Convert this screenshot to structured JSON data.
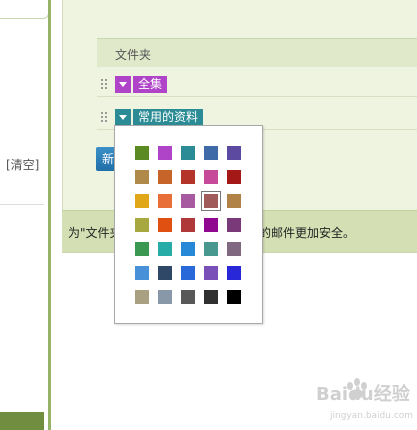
{
  "sidebar": {
    "clear_link": "[清空]"
  },
  "folders": {
    "header": "文件夹",
    "items": [
      {
        "label": "全集",
        "color": "#b044c8"
      },
      {
        "label": "常用的资料",
        "color": "#2b8c96"
      }
    ]
  },
  "new_button": {
    "label": "新"
  },
  "info_bar": {
    "text_left": "为\"文件夹",
    "text_right": "的邮件更加安全。"
  },
  "color_picker": {
    "selected": "#a05a5a",
    "rows": [
      [
        "#5b8a22",
        "#b044c8",
        "#2b8c96",
        "#3f6aa8",
        "#5b4aa0"
      ],
      [
        "#b08a4a",
        "#c7642a",
        "#b4342a",
        "#c74a9a",
        "#a41818"
      ],
      [
        "#e0a818",
        "#e87038",
        "#a85aa0",
        "#a05a5a",
        "#b08248"
      ],
      [
        "#a8a840",
        "#e05010",
        "#b03838",
        "#900890",
        "#7a3a7a"
      ],
      [
        "#3a9850",
        "#28aca8",
        "#2888d8",
        "#489890",
        "#806880"
      ],
      [
        "#4890d8",
        "#304868",
        "#2868d8",
        "#7850b8",
        "#2828d8"
      ],
      [
        "#a8a080",
        "#8898a8",
        "#585858",
        "#303030",
        "#000000"
      ]
    ]
  },
  "watermark": {
    "text": "Baidu经验",
    "url": "jingyan.baidu.com"
  }
}
